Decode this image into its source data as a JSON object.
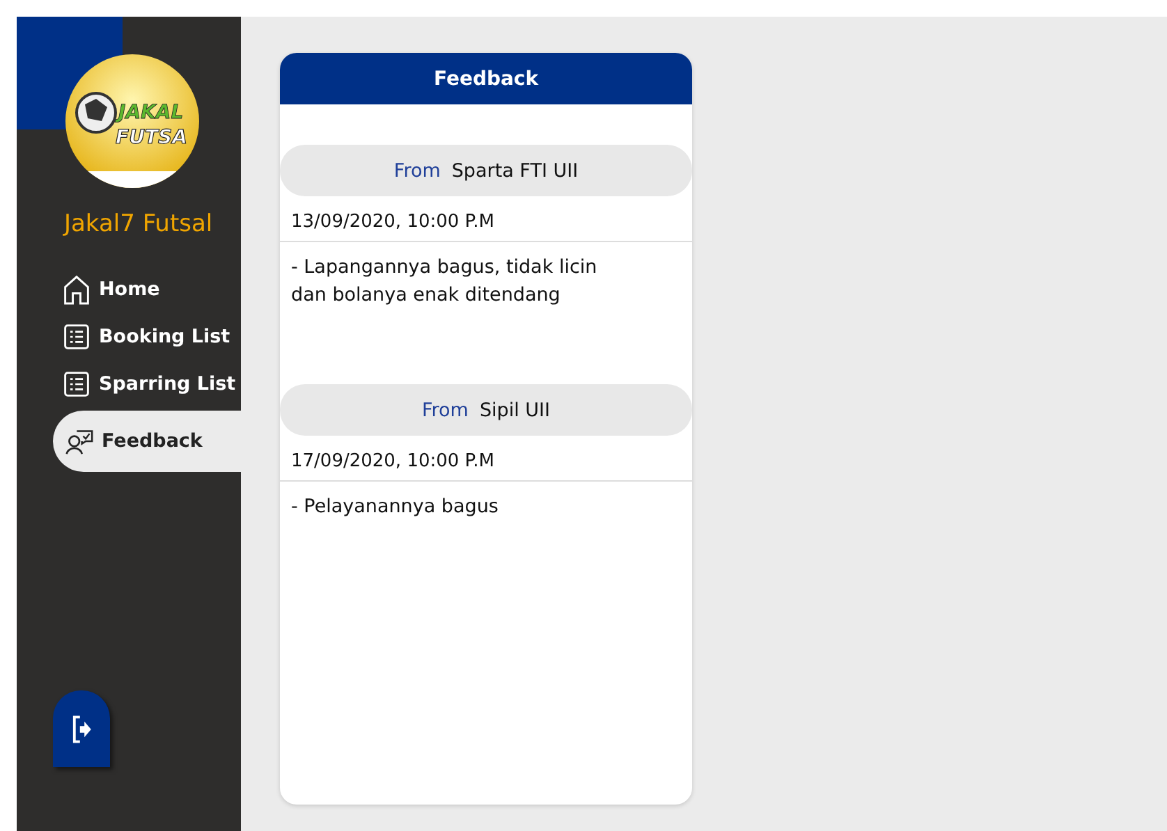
{
  "brand": {
    "logo_texts": [
      "JAKAL",
      "FUTSA"
    ],
    "name": "Jakal7 Futsal"
  },
  "nav": [
    {
      "label": "Home",
      "kind": "home",
      "selected": false
    },
    {
      "label": "Booking List",
      "kind": "list",
      "selected": false
    },
    {
      "label": "Sparring List",
      "kind": "list",
      "selected": false
    },
    {
      "label": "Feedback",
      "kind": "feedback",
      "selected": true
    }
  ],
  "card": {
    "title": "Feedback",
    "entries": [
      {
        "from_label": "From",
        "sender": "Sparta FTI UII",
        "datetime": "13/09/2020, 10:00 P.M",
        "message": "- Lapangannya bagus, tidak licin\ndan bolanya enak ditendang"
      },
      {
        "from_label": "From",
        "sender": "Sipil UII",
        "datetime": "17/09/2020, 10:00 P.M",
        "message": "- Pelayanannya bagus"
      }
    ]
  }
}
